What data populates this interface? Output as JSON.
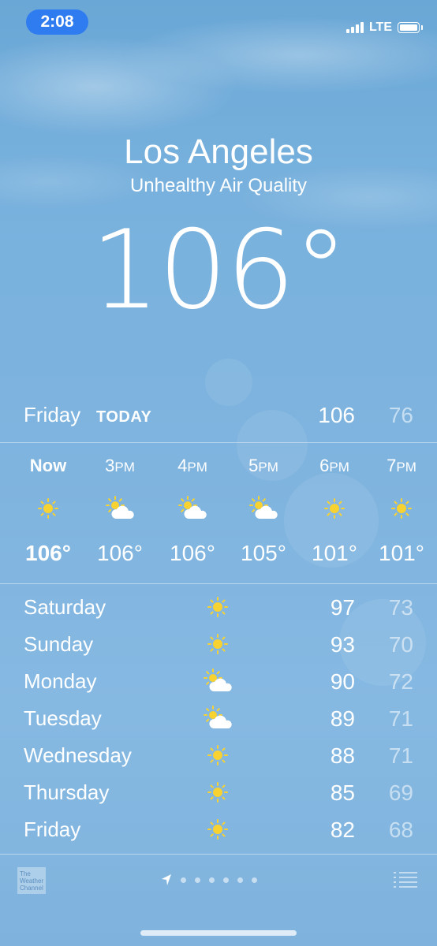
{
  "status_bar": {
    "time": "2:08",
    "network": "LTE",
    "icons": [
      "signal-icon",
      "battery-icon"
    ]
  },
  "location": {
    "city": "Los Angeles",
    "subtitle": "Unhealthy Air Quality",
    "temperature": "106°"
  },
  "today": {
    "day": "Friday",
    "label": "TODAY",
    "high": "106",
    "low": "76"
  },
  "hourly": [
    {
      "time": "Now",
      "suffix": "",
      "icon": "sun-icon",
      "temp": "106°"
    },
    {
      "time": "3",
      "suffix": "PM",
      "icon": "partly-cloudy-icon",
      "temp": "106°"
    },
    {
      "time": "4",
      "suffix": "PM",
      "icon": "partly-cloudy-icon",
      "temp": "106°"
    },
    {
      "time": "5",
      "suffix": "PM",
      "icon": "partly-cloudy-icon",
      "temp": "105°"
    },
    {
      "time": "6",
      "suffix": "PM",
      "icon": "sun-icon",
      "temp": "101°"
    },
    {
      "time": "7",
      "suffix": "PM",
      "icon": "sun-icon",
      "temp": "101°"
    }
  ],
  "daily": [
    {
      "day": "Saturday",
      "icon": "sun-icon",
      "high": "97",
      "low": "73"
    },
    {
      "day": "Sunday",
      "icon": "sun-icon",
      "high": "93",
      "low": "70"
    },
    {
      "day": "Monday",
      "icon": "partly-cloudy-icon",
      "high": "90",
      "low": "72"
    },
    {
      "day": "Tuesday",
      "icon": "partly-cloudy-icon",
      "high": "89",
      "low": "71"
    },
    {
      "day": "Wednesday",
      "icon": "sun-icon",
      "high": "88",
      "low": "71"
    },
    {
      "day": "Thursday",
      "icon": "sun-icon",
      "high": "85",
      "low": "69"
    },
    {
      "day": "Friday",
      "icon": "sun-icon",
      "high": "82",
      "low": "68"
    }
  ],
  "footer": {
    "logo_text": "The Weather Channel",
    "page_count": 7,
    "icons": [
      "location-arrow-icon",
      "list-icon"
    ]
  },
  "colors": {
    "time_pill": "#2f7cf0",
    "sun": "#f7d230",
    "sky_top": "#6aa7d6",
    "sky_bottom": "#7fb3dd"
  }
}
